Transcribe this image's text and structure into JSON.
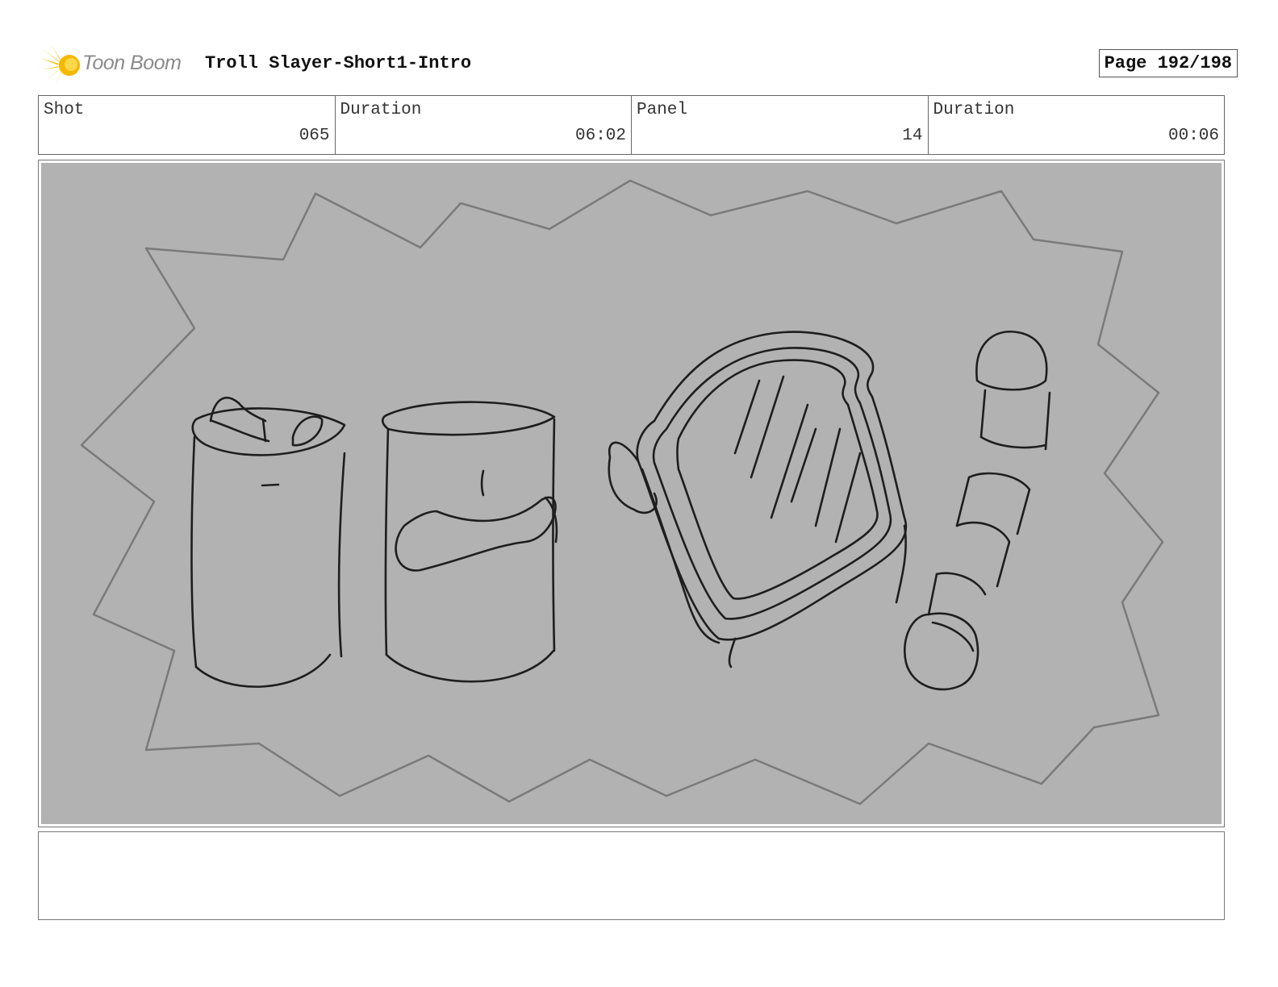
{
  "header": {
    "logo_text": "Toon Boom",
    "project_title": "Troll Slayer-Short1-Intro",
    "page_label": "Page 192/198"
  },
  "info": {
    "shot_label": "Shot",
    "shot_value": "065",
    "shot_duration_label": "Duration",
    "shot_duration_value": "06:02",
    "panel_label": "Panel",
    "panel_value": "14",
    "panel_duration_label": "Duration",
    "panel_duration_value": "00:06"
  },
  "panel": {
    "background_color": "#b2b2b2",
    "burst_color": "#7a7a7a",
    "line_color": "#1e1e1e"
  },
  "notes": {
    "text": ""
  }
}
